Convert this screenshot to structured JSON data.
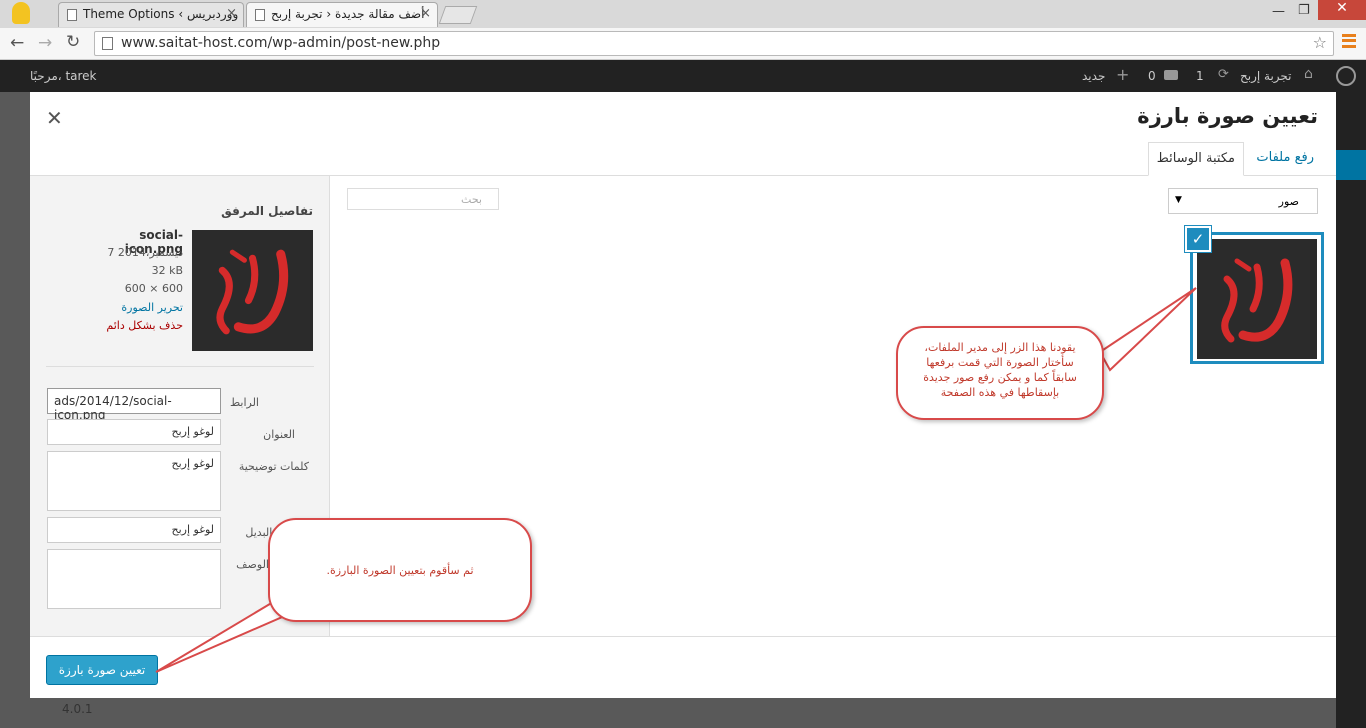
{
  "browser": {
    "tabs": [
      {
        "label": "Theme Options ‹ ووردبريس"
      },
      {
        "label": "أضف مقالة جديدة ‹ تجربة إربح"
      }
    ],
    "url": "www.saitat-host.com/wp-admin/post-new.php"
  },
  "adminbar": {
    "site_name": "تجربة إربح",
    "updates": "1",
    "comments": "0",
    "new_label": "جديد",
    "greeting": "مرحبًا، tarek"
  },
  "modal": {
    "title": "تعيين صورة بارزة",
    "tabs": {
      "upload": "رفع ملفات",
      "library": "مكتبة الوسائط"
    },
    "filter": {
      "selected": "صور"
    },
    "search": {
      "placeholder": "بحث"
    },
    "details": {
      "heading": "تفاصيل المرفق",
      "filename": "social-icon.png",
      "date": "7 ديسمبر،2014",
      "size": "32 kB",
      "dimensions": "600 × 600",
      "edit_link": "تحرير الصورة",
      "delete_link": "حذف بشكل دائم"
    },
    "fields": {
      "url_label": "الرابط",
      "url_value": "ads/2014/12/social-icon.png",
      "title_label": "العنوان",
      "title_value": "لوغو إربح",
      "caption_label": "كلمات توضيحية",
      "caption_value": "لوغو إربح",
      "alt_label": "النص البديل",
      "alt_value": "لوغو إربح",
      "description_label": "الوصف",
      "description_value": ""
    },
    "button": "تعيين صورة بارزة"
  },
  "callouts": {
    "media_note": "يقودنا هذا الزر إلى مدير الملفات، سأختار الصورة التي قمت برفعها سابقاً كما و يمكن رفع صور جديدة بإسقاطها في هذه الصفحة",
    "button_note": "ثم سأقوم بتعيين الصورة البارزة."
  },
  "footer": {
    "version": "4.0.1"
  },
  "colors": {
    "primary": "#2ea2cc",
    "callout_border": "#d84a4a",
    "logo_red": "#d62b2b"
  }
}
